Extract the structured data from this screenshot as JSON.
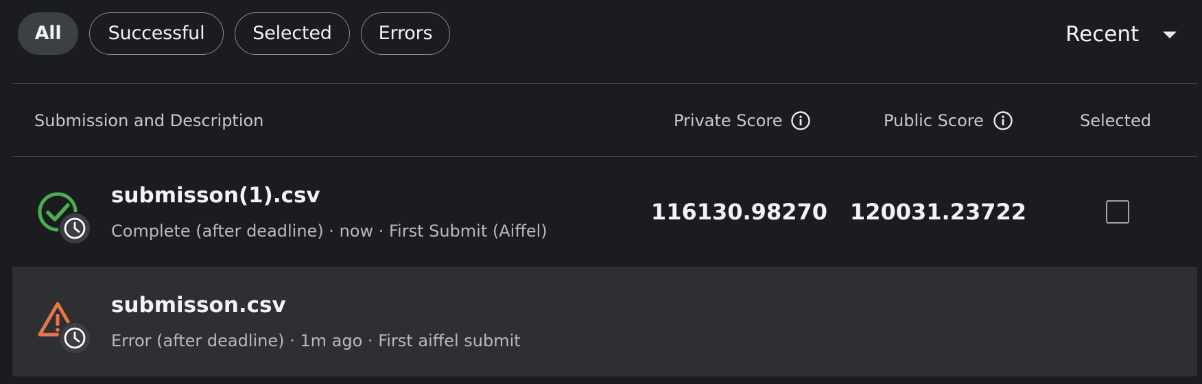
{
  "filters": {
    "tabs": [
      {
        "label": "All",
        "active": true
      },
      {
        "label": "Successful",
        "active": false
      },
      {
        "label": "Selected",
        "active": false
      },
      {
        "label": "Errors",
        "active": false
      }
    ],
    "sort": {
      "label": "Recent",
      "icon": "chevron-down-icon"
    }
  },
  "table": {
    "columns": {
      "submission": "Submission and Description",
      "private_score": "Private Score",
      "public_score": "Public Score",
      "selected": "Selected"
    },
    "rows": [
      {
        "status": "success",
        "status_icon": "check-circle-icon",
        "overlay_icon": "clock-icon",
        "filename": "submisson(1).csv",
        "description": "Complete (after deadline) · now · First Submit (Aiffel)",
        "private_score": "116130.98270",
        "public_score": "120031.23722",
        "selected": false
      },
      {
        "status": "error",
        "status_icon": "warning-triangle-icon",
        "overlay_icon": "clock-icon",
        "filename": "submisson.csv",
        "description": "Error (after deadline) · 1m ago · First aiffel submit"
      }
    ]
  },
  "colors": {
    "background": "#1b1c20",
    "success": "#4caf50",
    "error": "#e8754a",
    "active_pill": "#3c4044"
  }
}
